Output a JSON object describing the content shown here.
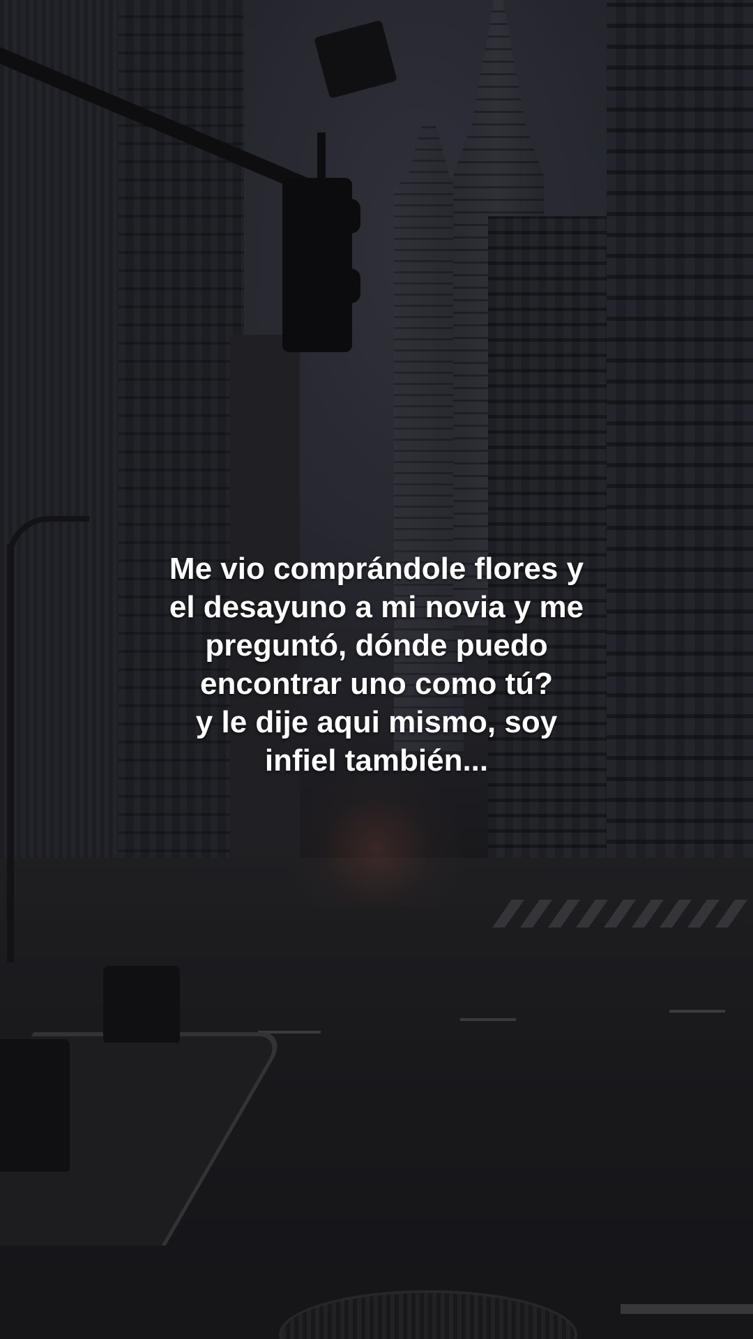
{
  "caption": {
    "lines": [
      "Me vio comprándole flores y",
      "el desayuno a mi novia y me",
      "preguntó, dónde puedo",
      "encontrar uno como tú?",
      "y le dije aqui mismo, soy",
      "infiel también..."
    ]
  },
  "background": {
    "scene": "night-city-street",
    "tone_color": "#2c2d36"
  }
}
